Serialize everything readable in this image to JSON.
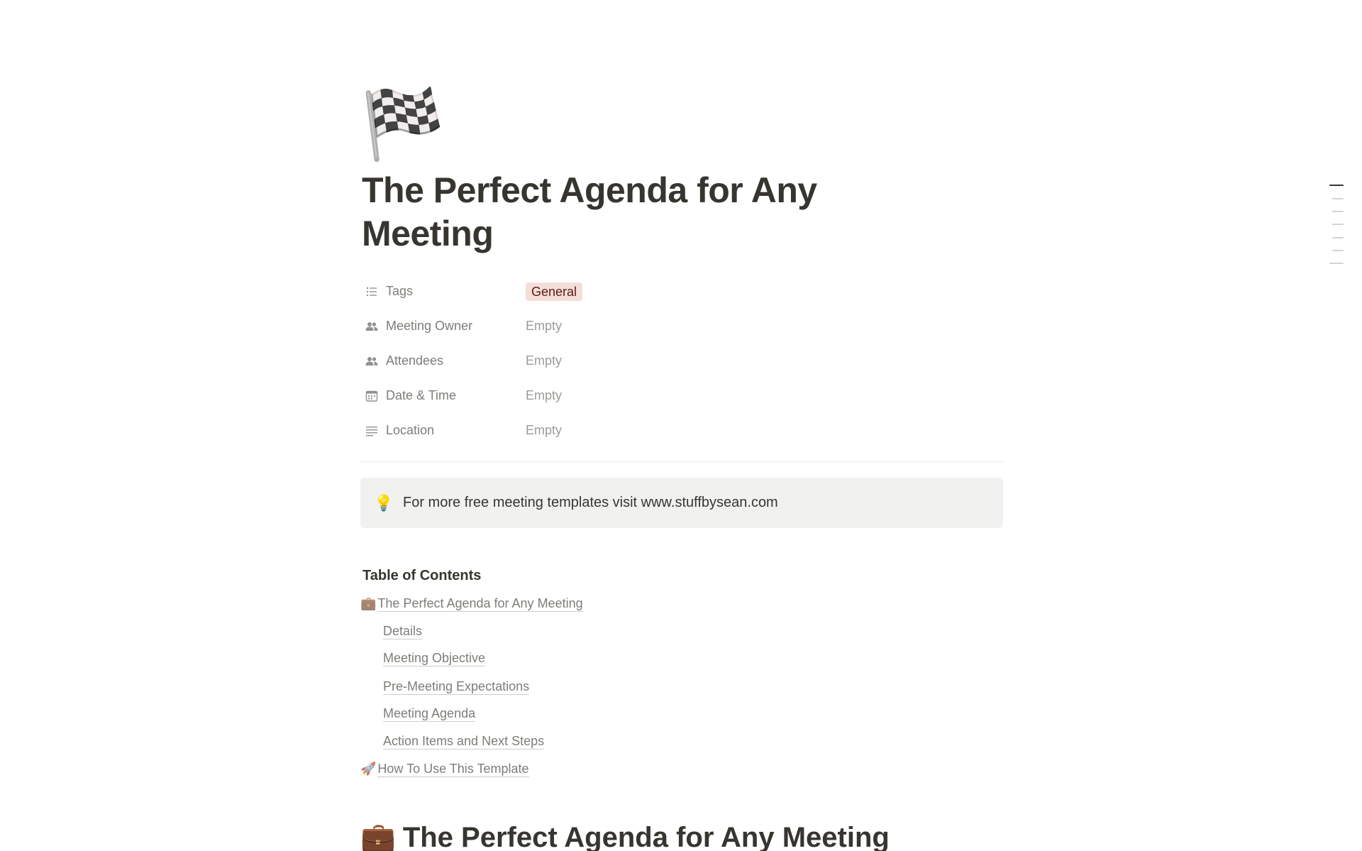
{
  "page": {
    "icon": "🏁",
    "title": "The Perfect Agenda for Any Meeting"
  },
  "properties": [
    {
      "icon": "list-icon",
      "label": "Tags",
      "value": "General",
      "is_tag": true,
      "tag_bg": "#f4dfd8",
      "tag_color": "#5d1715"
    },
    {
      "icon": "people-icon",
      "label": "Meeting Owner",
      "value": "Empty",
      "is_tag": false
    },
    {
      "icon": "people-icon",
      "label": "Attendees",
      "value": "Empty",
      "is_tag": false
    },
    {
      "icon": "calendar-icon",
      "label": "Date & Time",
      "value": "Empty",
      "is_tag": false
    },
    {
      "icon": "text-lines-icon",
      "label": "Location",
      "value": "Empty",
      "is_tag": false
    }
  ],
  "callout": {
    "icon": "💡",
    "text": "For more free meeting templates visit www.stuffbysean.com"
  },
  "toc": {
    "heading": "Table of Contents",
    "items": [
      {
        "emoji": "💼",
        "label": "The Perfect Agenda for Any Meeting",
        "level": 0
      },
      {
        "emoji": "",
        "label": "Details",
        "level": 1
      },
      {
        "emoji": "",
        "label": "Meeting Objective",
        "level": 1
      },
      {
        "emoji": "",
        "label": "Pre-Meeting Expectations",
        "level": 1
      },
      {
        "emoji": "",
        "label": "Meeting Agenda",
        "level": 1
      },
      {
        "emoji": "",
        "label": "Action Items and Next Steps",
        "level": 1
      },
      {
        "emoji": "🚀",
        "label": "How To Use This Template",
        "level": 0
      }
    ]
  },
  "heading1": {
    "emoji": "💼",
    "text": "The Perfect Agenda for Any Meeting"
  },
  "outline": {
    "active_index": 0,
    "count": 7,
    "active_color": "#37352f",
    "inactive_color": "#d3d3d1"
  }
}
